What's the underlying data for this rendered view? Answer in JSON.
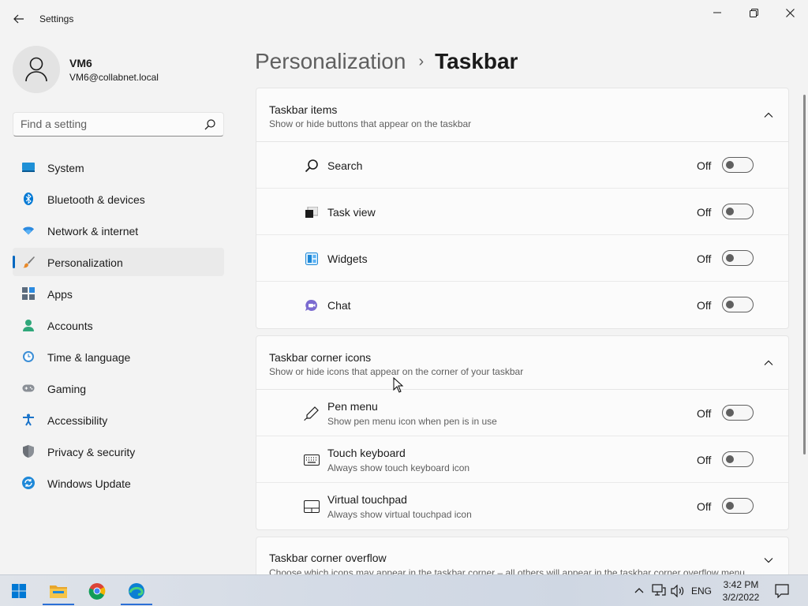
{
  "window": {
    "title": "Settings",
    "colors": {
      "accent": "#0067c0",
      "background": "#f3f3f3",
      "card": "#fbfbfb"
    }
  },
  "profile": {
    "name": "VM6",
    "email": "VM6@collabnet.local"
  },
  "search": {
    "placeholder": "Find a setting"
  },
  "sidebar": {
    "items": [
      {
        "label": "System",
        "icon": "system-icon"
      },
      {
        "label": "Bluetooth & devices",
        "icon": "bluetooth-icon"
      },
      {
        "label": "Network & internet",
        "icon": "wifi-icon"
      },
      {
        "label": "Personalization",
        "icon": "brush-icon",
        "active": true
      },
      {
        "label": "Apps",
        "icon": "apps-icon"
      },
      {
        "label": "Accounts",
        "icon": "accounts-icon"
      },
      {
        "label": "Time & language",
        "icon": "clock-icon"
      },
      {
        "label": "Gaming",
        "icon": "gamepad-icon"
      },
      {
        "label": "Accessibility",
        "icon": "accessibility-icon"
      },
      {
        "label": "Privacy & security",
        "icon": "shield-icon"
      },
      {
        "label": "Windows Update",
        "icon": "update-icon"
      }
    ]
  },
  "breadcrumb": {
    "parent": "Personalization",
    "separator": "›",
    "current": "Taskbar"
  },
  "taskbar_items": {
    "title": "Taskbar items",
    "subtitle": "Show or hide buttons that appear on the taskbar",
    "rows": [
      {
        "label": "Search",
        "state": "Off",
        "icon": "search-icon"
      },
      {
        "label": "Task view",
        "state": "Off",
        "icon": "task-view-icon"
      },
      {
        "label": "Widgets",
        "state": "Off",
        "icon": "widgets-icon"
      },
      {
        "label": "Chat",
        "state": "Off",
        "icon": "chat-icon"
      }
    ]
  },
  "corner_icons": {
    "title": "Taskbar corner icons",
    "subtitle": "Show or hide icons that appear on the corner of your taskbar",
    "rows": [
      {
        "label": "Pen menu",
        "sub": "Show pen menu icon when pen is in use",
        "state": "Off",
        "icon": "pen-icon"
      },
      {
        "label": "Touch keyboard",
        "sub": "Always show touch keyboard icon",
        "state": "Off",
        "icon": "keyboard-icon"
      },
      {
        "label": "Virtual touchpad",
        "sub": "Always show virtual touchpad icon",
        "state": "Off",
        "icon": "touchpad-icon"
      }
    ]
  },
  "corner_overflow": {
    "title": "Taskbar corner overflow",
    "subtitle": "Choose which icons may appear in the taskbar corner – all others will appear in the taskbar corner overflow menu"
  },
  "taskbar": {
    "apps": [
      "start-icon",
      "file-explorer-icon",
      "chrome-icon",
      "edge-icon"
    ],
    "language": "ENG",
    "time": "3:42 PM",
    "date": "3/2/2022"
  }
}
